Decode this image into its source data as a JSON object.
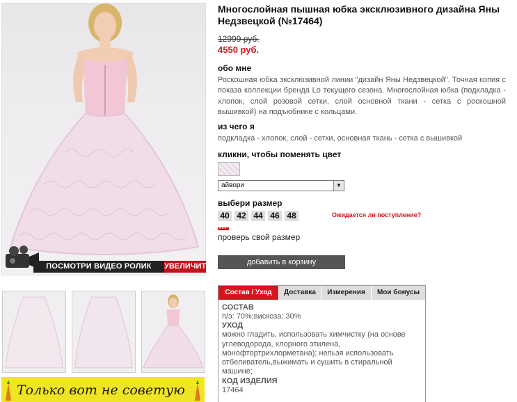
{
  "product": {
    "title": "Многослойная пышная юбка эксклюзивного дизайна Яны Недзвецкой (№17464)",
    "old_price": "12999 руб.",
    "new_price": "4550 руб."
  },
  "about": {
    "heading": "обо мне",
    "text": "Роскошная юбка эксклюзивной линии \"дизайн Яны Недзвецкой\". Точная копия с показа коллекции бренда Lo текущего сезона. Многослойная юбка (подкладка - хлопок, слой розовой сетки, слой основной ткани - сетка с роскошной вышивкой) на подъюбнике с кольцами."
  },
  "material": {
    "heading": "из чего я",
    "text": "подкладка - хлопок, слой - сетки, основная ткань - сетка с вышивкой"
  },
  "color": {
    "heading": "кликни, чтобы поменять цвет",
    "selected": "айвори"
  },
  "size": {
    "heading": "выбери размер",
    "options": [
      "40",
      "42",
      "44",
      "46",
      "48"
    ],
    "expected_link": "Ожидается ли поступление?",
    "check_link": "проверь свой размер"
  },
  "cart": {
    "add_label": "добавить в корзину"
  },
  "media": {
    "video_label": "ПОСМОТРИ ВИДЕО РОЛИК",
    "zoom_label": "УВЕЛИЧИТЬ"
  },
  "banner": {
    "text": "Только вот не советую"
  },
  "tabs": {
    "items": [
      "Состав / Уход",
      "Доставка",
      "Измерения",
      "Мои бонусы"
    ],
    "composition_heading": "СОСТАВ",
    "composition_text": "п/э: 70%;вискоза: 30%",
    "care_heading": "УХОД",
    "care_text": "можно гладить, использовать химчистку (на основе углеводорода, хлорного этилена, монофтортрихлорметана); нельзя использовать отбеливатель,выжимать и сушить в стиральной машине;",
    "code_heading": "КОД ИЗДЕЛИЯ",
    "code_value": "17464"
  },
  "colors": {
    "accent": "#d7141d",
    "button_dark": "#555555",
    "banner_yellow": "#f0e524"
  }
}
